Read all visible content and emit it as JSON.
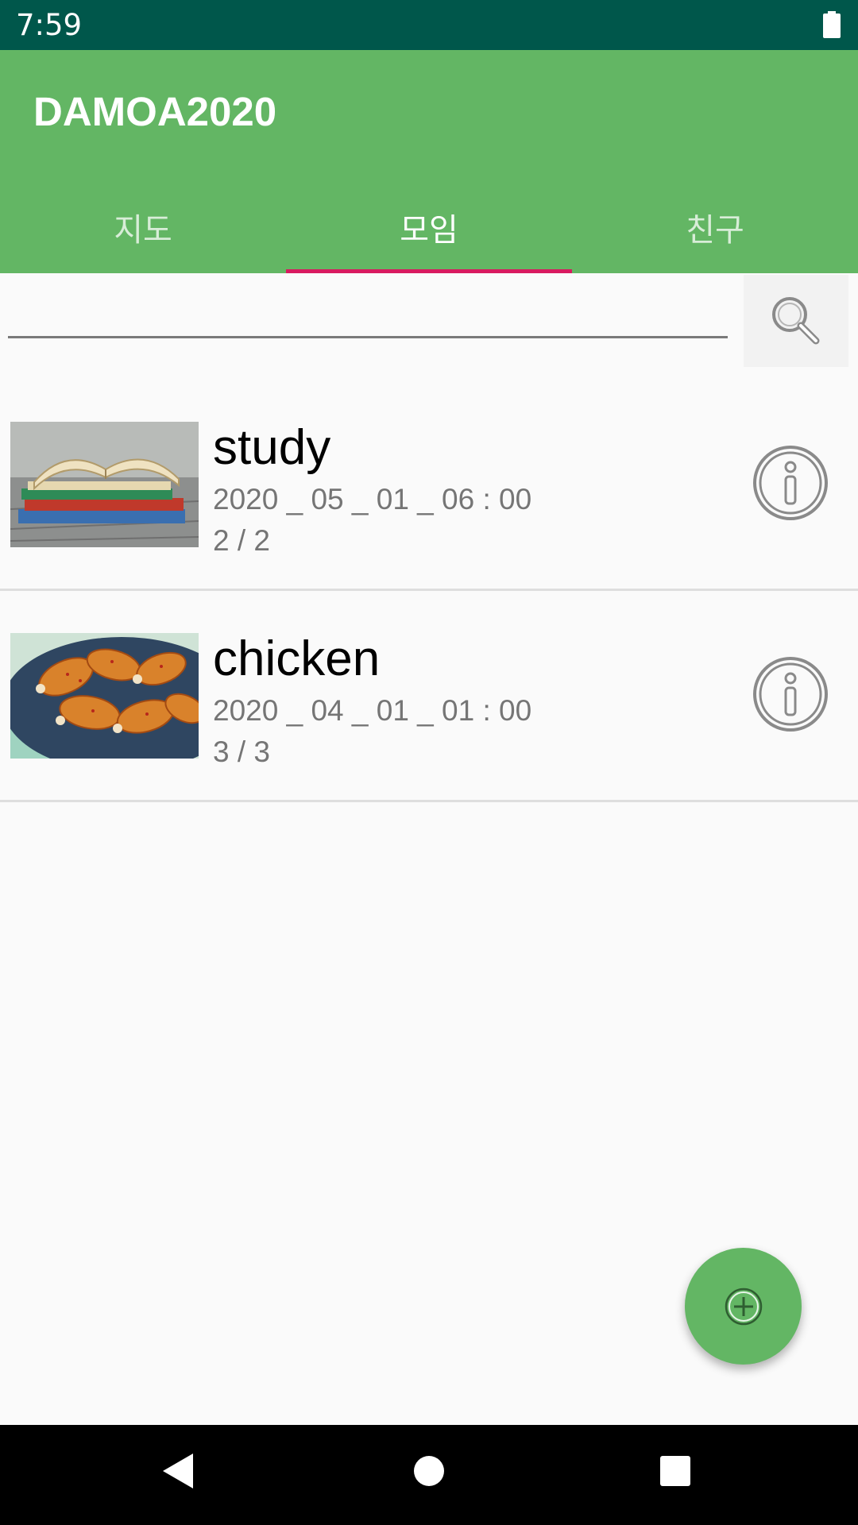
{
  "status_bar": {
    "time": "7:59"
  },
  "app_bar": {
    "title": "DAMOA2020",
    "tabs": [
      {
        "label": "지도",
        "active": false
      },
      {
        "label": "모임",
        "active": true
      },
      {
        "label": "친구",
        "active": false
      }
    ]
  },
  "search": {
    "value": "",
    "placeholder": ""
  },
  "meetings": [
    {
      "title": "study",
      "datetime": "2020 _ 05 _ 01 _ 06 : 00",
      "members": "2 / 2",
      "image": "books-photo"
    },
    {
      "title": "chicken",
      "datetime": "2020 _ 04 _ 01 _ 01 : 00",
      "members": "3 / 3",
      "image": "chicken-drumsticks-photo"
    }
  ],
  "colors": {
    "status_bar": "#00574b",
    "primary": "#63b664",
    "tab_indicator": "#d81b60",
    "fab": "#63b664"
  },
  "icons": {
    "search": "magnifier-icon",
    "info": "info-icon",
    "fab": "add-circle-icon",
    "battery": "battery-icon"
  }
}
